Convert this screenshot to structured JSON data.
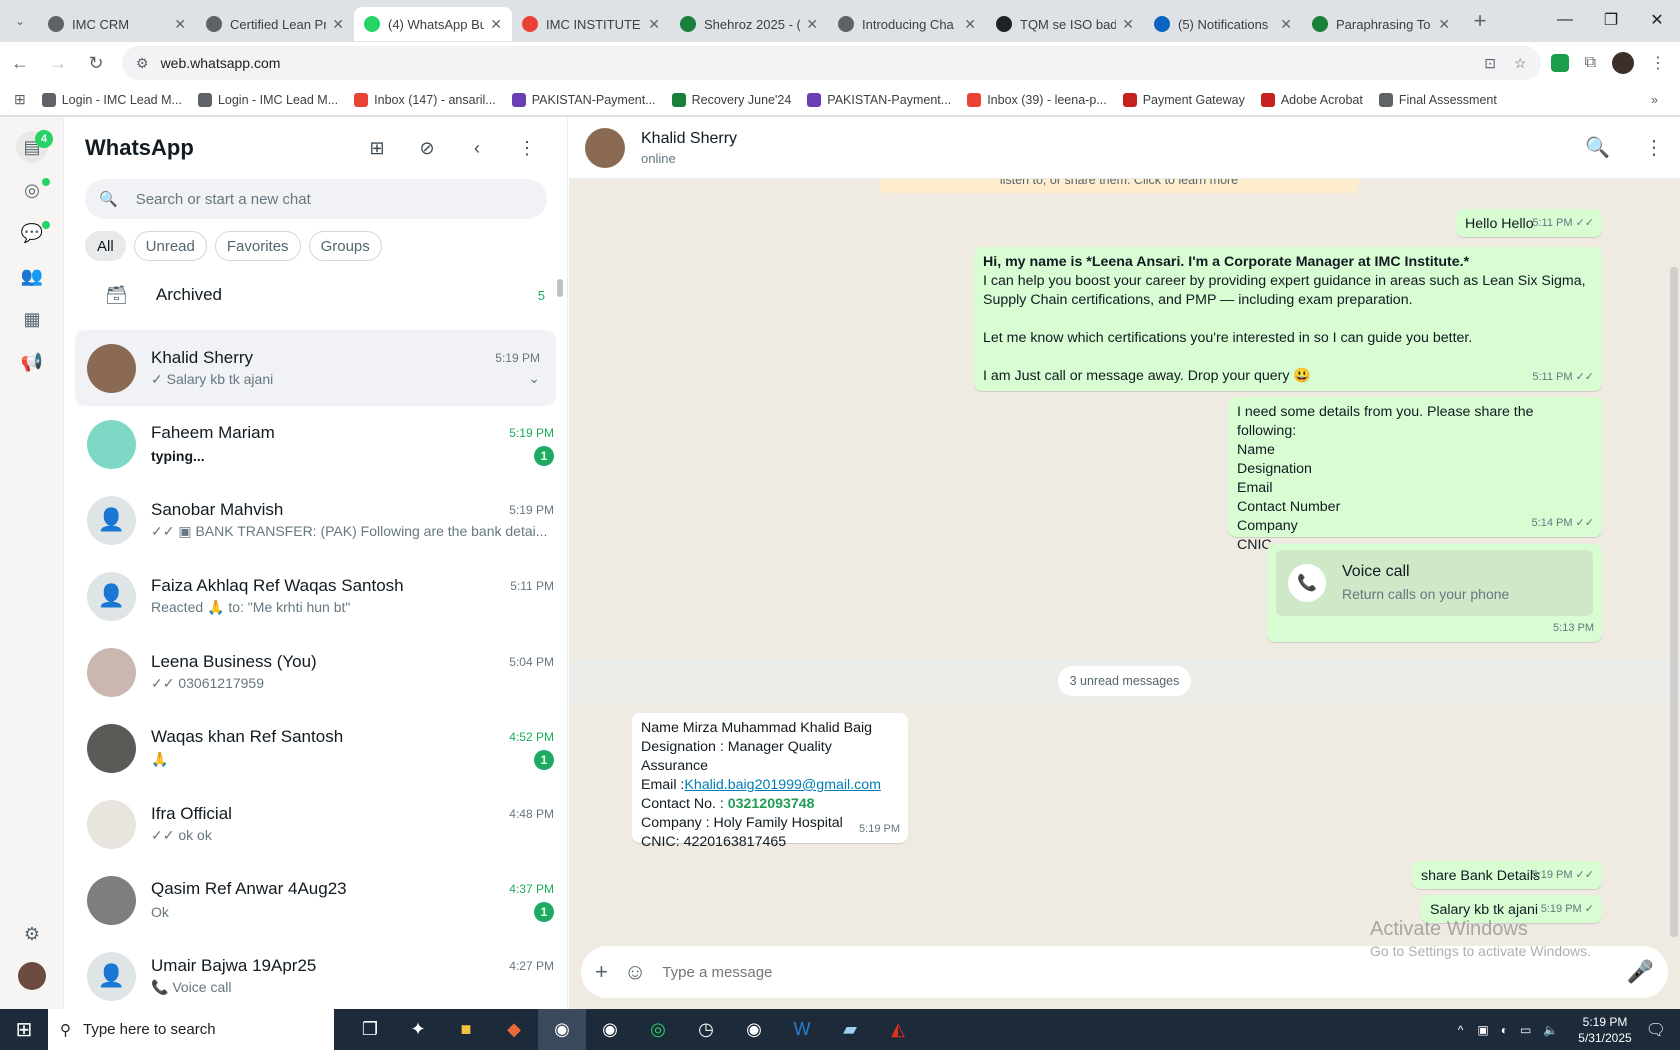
{
  "browser": {
    "tabs": [
      {
        "title": "IMC CRM",
        "color": "#5f6368",
        "active": false
      },
      {
        "title": "Certified Lean Pr",
        "color": "#5f6368",
        "active": false
      },
      {
        "title": "(4) WhatsApp Bu",
        "color": "#25d366",
        "active": true
      },
      {
        "title": "IMC INSTITUTE |",
        "color": "#ea4335",
        "active": false
      },
      {
        "title": "Shehroz 2025 - (",
        "color": "#188038",
        "active": false
      },
      {
        "title": "Introducing Cha",
        "color": "#5f6368",
        "active": false
      },
      {
        "title": "TQM se ISO bad",
        "color": "#202124",
        "active": false
      },
      {
        "title": "(5) Notifications",
        "color": "#0a66c2",
        "active": false
      },
      {
        "title": "Paraphrasing To",
        "color": "#188038",
        "active": false
      }
    ],
    "url": "web.whatsapp.com",
    "bookmarks": [
      {
        "label": "Login - IMC Lead M...",
        "color": "#5f6368"
      },
      {
        "label": "Login - IMC Lead M...",
        "color": "#5f6368"
      },
      {
        "label": "Inbox (147) - ansaril...",
        "color": "#ea4335"
      },
      {
        "label": "PAKISTAN-Payment...",
        "color": "#6a3fb5"
      },
      {
        "label": "Recovery June'24",
        "color": "#188038"
      },
      {
        "label": "PAKISTAN-Payment...",
        "color": "#6a3fb5"
      },
      {
        "label": "Inbox (39) - leena-p...",
        "color": "#ea4335"
      },
      {
        "label": "Payment Gateway",
        "color": "#c5221f"
      },
      {
        "label": "Adobe Acrobat",
        "color": "#c5221f"
      },
      {
        "label": "Final Assessment",
        "color": "#5f6368"
      }
    ]
  },
  "rail": {
    "chats_badge": "4"
  },
  "sidebar": {
    "title": "WhatsApp",
    "search_placeholder": "Search or start a new chat",
    "filters": [
      "All",
      "Unread",
      "Favorites",
      "Groups"
    ],
    "archived_label": "Archived",
    "archived_count": "5",
    "chats": [
      {
        "name": "Khalid Sherry",
        "time": "5:19 PM",
        "preview": "✓ Salary kb tk ajani",
        "unread": "",
        "avatar": "#8a6a52",
        "selected": true,
        "green": false
      },
      {
        "name": "Faheem Mariam",
        "time": "5:19 PM",
        "preview": "typing...",
        "unread": "1",
        "avatar": "#7fd8c6",
        "selected": false,
        "green": true
      },
      {
        "name": "Sanobar Mahvish",
        "time": "5:19 PM",
        "preview": "✓✓ ▣ BANK TRANSFER: (PAK) Following are the bank detai...",
        "unread": "",
        "avatar": "",
        "selected": false,
        "green": false
      },
      {
        "name": "Faiza Akhlaq Ref Waqas Santosh",
        "time": "5:11 PM",
        "preview": "Reacted 🙏 to: \"Me krhti hun bt\"",
        "unread": "",
        "avatar": "",
        "selected": false,
        "green": false
      },
      {
        "name": "Leena Business (You)",
        "time": "5:04 PM",
        "preview": "✓✓ 03061217959",
        "unread": "",
        "avatar": "#c9b7b0",
        "selected": false,
        "green": false
      },
      {
        "name": "Waqas khan Ref Santosh",
        "time": "4:52 PM",
        "preview": "🙏",
        "unread": "1",
        "avatar": "#5b5a56",
        "selected": false,
        "green": true
      },
      {
        "name": "Ifra Official",
        "time": "4:48 PM",
        "preview": "✓✓ ok ok",
        "unread": "",
        "avatar": "#e8e4de",
        "selected": false,
        "green": false
      },
      {
        "name": "Qasim Ref Anwar 4Aug23",
        "time": "4:37 PM",
        "preview": "Ok",
        "unread": "1",
        "avatar": "#7d7f7c",
        "selected": false,
        "green": true
      },
      {
        "name": "Umair Bajwa 19Apr25",
        "time": "4:27 PM",
        "preview": "📞 Voice call",
        "unread": "",
        "avatar": "",
        "selected": false,
        "green": false
      }
    ]
  },
  "conversation": {
    "contact_name": "Khalid Sherry",
    "contact_status": "online",
    "notice": "listen to, or share them. Click to learn more",
    "messages": {
      "m1": {
        "text": "Hello Hello",
        "time": "5:11 PM ✓✓"
      },
      "m2": {
        "line1": "Hi, my name is *Leena Ansari. I'm a Corporate Manager at IMC Institute.*",
        "line2": "I can help you boost your career by providing expert guidance in areas such as Lean Six Sigma, Supply Chain certifications, and PMP — including exam preparation.",
        "line3": "Let me know which certifications you're interested in so I can guide you better.",
        "line4": "I am Just call or message away. Drop your query 😃",
        "time": "5:11 PM ✓✓"
      },
      "m3": {
        "lines": [
          "I need some details from you. Please share the following:",
          "Name",
          "Designation",
          "Email",
          "Contact Number",
          "Company",
          "CNIC"
        ],
        "time": "5:14 PM ✓✓"
      },
      "m4": {
        "title": "Voice call",
        "subtitle": "Return calls on your phone",
        "time": "5:13 PM"
      },
      "unread_label": "3 unread messages",
      "m5": {
        "name": "Name Mirza Muhammad Khalid Baig",
        "designation": "Designation : Manager Quality Assurance",
        "email_label": "Email :",
        "email": "Khalid.baig201999@gmail.com",
        "contact_label": "Contact No. : ",
        "contact": "03212093748",
        "company": "Company : Holy Family Hospital",
        "cnic": "CNIC: 4220163817465",
        "time": "5:19 PM"
      },
      "m6": {
        "text": "share Bank Details",
        "time": "5:19 PM ✓✓"
      },
      "m7": {
        "text": "Salary kb tk ajani",
        "time": "5:19 PM ✓"
      }
    },
    "composer_placeholder": "Type a message"
  },
  "watermark": {
    "title": "Activate Windows",
    "subtitle": "Go to Settings to activate Windows."
  },
  "taskbar": {
    "search": "Type here to search",
    "time": "5:19 PM",
    "date": "5/31/2025"
  }
}
